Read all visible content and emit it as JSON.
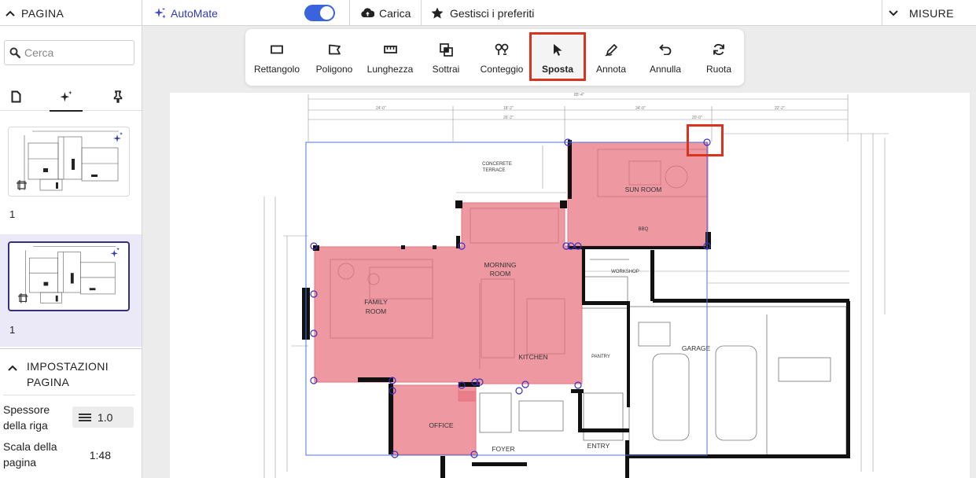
{
  "topbar": {
    "pagina_label": "PAGINA",
    "automate_label": "AutoMate",
    "automate_enabled": true,
    "carica_label": "Carica",
    "preferiti_label": "Gestisci i preferiti",
    "misure_label": "MISURE"
  },
  "sidebar": {
    "search_placeholder": "Cerca",
    "tabs": [
      {
        "icon": "page-icon"
      },
      {
        "icon": "sparkle-icon",
        "active": true
      },
      {
        "icon": "pin-icon"
      }
    ],
    "pages": [
      {
        "number": "1",
        "selected": false
      },
      {
        "number": "1",
        "selected": true
      }
    ],
    "settings": {
      "title_line1": "IMPOSTAZIONI",
      "title_line2": "PAGINA",
      "thickness_label_1": "Spessore",
      "thickness_label_2": "della riga",
      "thickness_value": "1.0",
      "scale_label_1": "Scala della",
      "scale_label_2": "pagina",
      "scale_value": "1:48"
    }
  },
  "toolbar": {
    "tools": [
      {
        "label": "Rettangolo",
        "icon": "rectangle-icon"
      },
      {
        "label": "Poligono",
        "icon": "polygon-icon"
      },
      {
        "label": "Lunghezza",
        "icon": "ruler-icon"
      },
      {
        "label": "Sottrai",
        "icon": "subtract-icon"
      },
      {
        "label": "Conteggio",
        "icon": "count-icon"
      },
      {
        "label": "Sposta",
        "icon": "cursor-icon",
        "active": true
      },
      {
        "label": "Annota",
        "icon": "annotate-icon"
      },
      {
        "label": "Annulla",
        "icon": "undo-icon"
      },
      {
        "label": "Ruota",
        "icon": "rotate-icon"
      }
    ]
  },
  "plan": {
    "rooms": [
      "FAMILY ROOM",
      "MORNING ROOM",
      "SUN ROOM",
      "KITCHEN",
      "OFFICE",
      "GARAGE",
      "PANTRY",
      "WORKSHOP",
      "FOYER",
      "ENTRY",
      "CONCERETE TERRACE",
      "BBQ"
    ],
    "colors": {
      "room_fill": "#e8727e",
      "selection": "#4a74d4",
      "handle": "#3b2fc0",
      "highlight": "#d9321f"
    }
  }
}
